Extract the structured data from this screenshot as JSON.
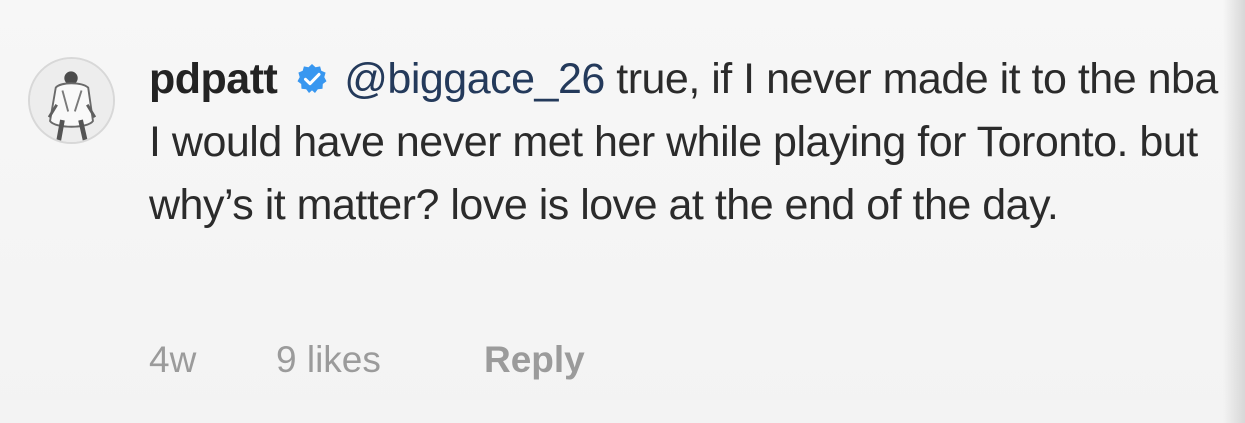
{
  "comment": {
    "username": "pdpatt",
    "mention": "@biggace_26",
    "text": " true, if I never made it to the nba I would have never met her while playing for Toronto. but why’s it matter? love is love at the end of the day.",
    "time": "4w",
    "likes": "9 likes",
    "reply_label": "Reply",
    "verified_icon": "verified-badge-icon",
    "avatar_icon": "profile-avatar"
  },
  "colors": {
    "text": "#2b2b2b",
    "meta": "#9b9b9b",
    "verified": "#3897f0",
    "mention": "#243a5b"
  }
}
